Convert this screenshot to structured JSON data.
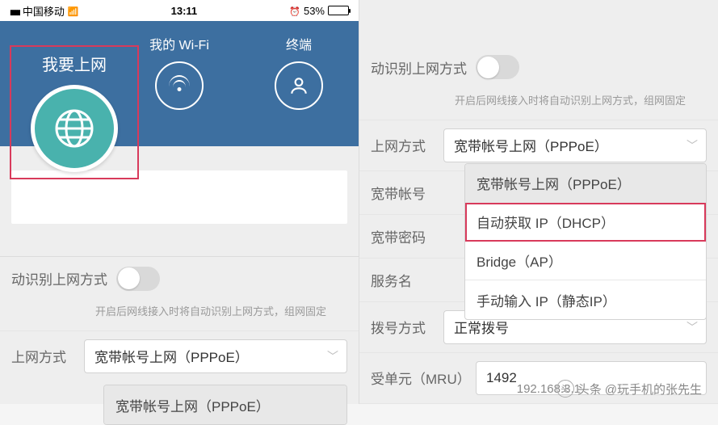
{
  "status_bar": {
    "carrier": "中国移动",
    "time": "13:11",
    "battery_pct": "53%"
  },
  "header": {
    "selected_title": "我要上网",
    "wifi_title": "我的 Wi-Fi",
    "terminal_title": "终端"
  },
  "left": {
    "auto_detect_label": "动识别上网方式",
    "auto_detect_hint": "开启后网线接入时将自动识别上网方式，组网固定",
    "method_label": "上网方式",
    "method_value": "宽带帐号上网（PPPoE）",
    "dropdown_opt1": "宽带帐号上网（PPPoE）"
  },
  "right": {
    "auto_detect_label": "动识别上网方式",
    "auto_detect_hint": "开启后网线接入时将自动识别上网方式，组网固定",
    "method_label": "上网方式",
    "method_value": "宽带帐号上网（PPPoE）",
    "account_label": "宽带帐号",
    "password_label": "宽带密码",
    "service_label": "服务名",
    "dial_label": "拨号方式",
    "dial_value": "正常拨号",
    "mru_label": "受单元（MRU）",
    "mru_value": "1492",
    "dropdown": {
      "opt1": "宽带帐号上网（PPPoE）",
      "opt2": "自动获取 IP（DHCP）",
      "opt3": "Bridge（AP）",
      "opt4": "手动输入 IP（静态IP）"
    }
  },
  "watermark": {
    "prefix": "头条",
    "at": "@玩手机的张先生"
  },
  "ghost_ip": "192.168.3.1"
}
